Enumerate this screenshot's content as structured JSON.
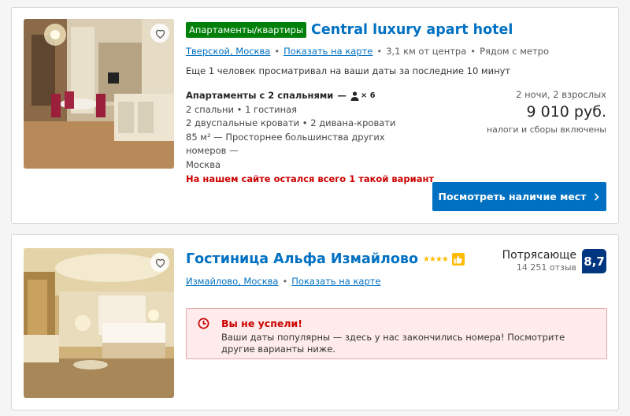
{
  "listings": [
    {
      "type_badge": "Апартаменты/квартиры",
      "name": "Central luxury apart hotel",
      "location_link": "Тверской, Москва",
      "map_link": "Показать на карте",
      "distance": "3,1 км от центра",
      "metro": "Рядом с метро",
      "viewers_note": "Еще 1 человек просматривал на ваши даты за последние 10 минут",
      "room": {
        "title": "Апартаменты с 2 спальнями",
        "dash": "—",
        "occupancy_prefix": "× 6",
        "lines": [
          "2 спальни • 1 гостиная",
          "2 двуспальные кровати • 2 дивана-кровати",
          "85 м² — Просторнее большинства других номеров —",
          "Москва"
        ],
        "scarcity": "На нашем сайте остался всего 1 такой вариант"
      },
      "price": {
        "config": "2 ночи, 2 взрослых",
        "amount": "9 010 руб.",
        "tax_note": "налоги и сборы включены"
      },
      "cta_label": "Посмотреть наличие мест"
    },
    {
      "name": "Гостиница Альфа Измайлово",
      "stars": 4,
      "stars_glyphs": "★★★★",
      "location_link": "Измайлово, Москва",
      "map_link": "Показать на карте",
      "review": {
        "word": "Потрясающе",
        "count": "14 251 отзыв",
        "score": "8,7"
      },
      "alert": {
        "title": "Вы не успели!",
        "body": "Ваши даты популярны — здесь у нас закончились номера! Посмотрите другие варианты ниже."
      }
    }
  ],
  "colors": {
    "brand_blue": "#0071c2",
    "badge_green": "#008009",
    "score_navy": "#003580",
    "alert_red": "#cc0000",
    "star_yellow": "#febb02"
  },
  "icons": [
    "heart-icon",
    "person-icon",
    "chevron-right-icon",
    "thumbs-up-icon",
    "clock-icon"
  ]
}
